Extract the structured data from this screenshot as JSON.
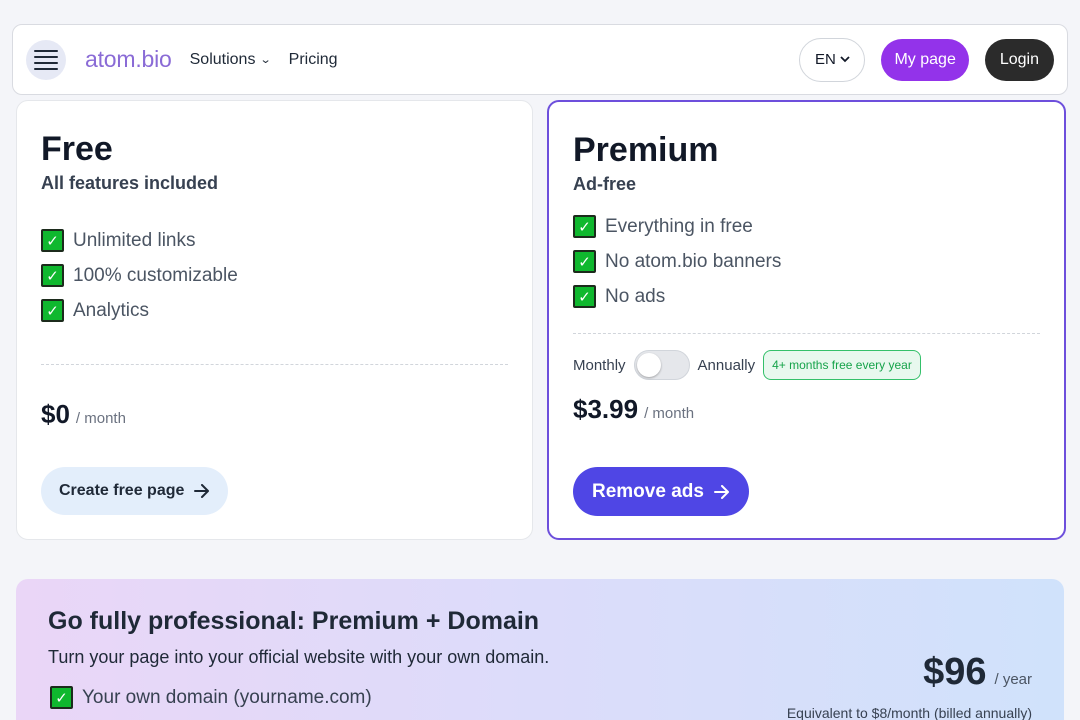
{
  "nav": {
    "logo": "atom.bio",
    "solutions": "Solutions",
    "pricing": "Pricing",
    "lang": "EN",
    "mypage": "My page",
    "login": "Login"
  },
  "free": {
    "title": "Free",
    "subtitle": "All features included",
    "features": [
      "Unlimited links",
      "100% customizable",
      "Analytics"
    ],
    "price": "$0",
    "per": "/ month",
    "cta": "Create free page"
  },
  "premium": {
    "title": "Premium",
    "subtitle": "Ad-free",
    "features": [
      "Everything in free",
      "No atom.bio banners",
      "No ads"
    ],
    "monthly": "Monthly",
    "annually": "Annually",
    "annual_selected": false,
    "badge": "4+ months free every year",
    "price": "$3.99",
    "per": "/ month",
    "cta": "Remove ads"
  },
  "promo": {
    "title": "Go fully professional: Premium + Domain",
    "description": "Turn your page into your official website with your own domain.",
    "feature": "Your own domain (yourname.com)",
    "price": "$96",
    "per": "/ year",
    "equivalent": "Equivalent to $8/month (billed annually)"
  },
  "colors": {
    "accent": "#4f46e5",
    "mypage": "#9333ea",
    "premium_border": "#6d4fdc",
    "check": "#0fb82e"
  },
  "icons": [
    "menu-icon",
    "chevron-down-icon",
    "check-icon",
    "arrow-right-icon"
  ]
}
